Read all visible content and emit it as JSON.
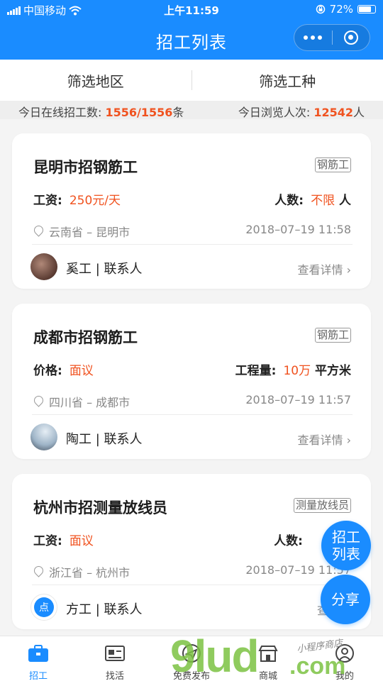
{
  "status": {
    "carrier": "中国移动",
    "time": "上午11:59",
    "battery": "72%"
  },
  "nav": {
    "title": "招工列表"
  },
  "filters": {
    "region": "筛选地区",
    "worktype": "筛选工种"
  },
  "stats": {
    "online_label": "今日在线招工数:",
    "online_value": "1556/1556",
    "online_unit": "条",
    "views_label": "今日浏览人次:",
    "views_value": "12542",
    "views_unit": "人"
  },
  "cards": [
    {
      "title": "昆明市招钢筋工",
      "tag": "钢筋工",
      "left_label": "工资:",
      "left_value": "250元/天",
      "right_label": "人数:",
      "right_value": "不限",
      "right_unit": "人",
      "location": "云南省 – 昆明市",
      "time": "2018–07–19 11:58",
      "contact": "奚工 | 联系人",
      "detail": "查看详情"
    },
    {
      "title": "成都市招钢筋工",
      "tag": "钢筋工",
      "left_label": "价格:",
      "left_value": "面议",
      "right_label": "工程量:",
      "right_value": "10万",
      "right_unit": "平方米",
      "location": "四川省 – 成都市",
      "time": "2018–07–19 11:57",
      "contact": "陶工 | 联系人",
      "detail": "查看详情"
    },
    {
      "title": "杭州市招测量放线员",
      "tag": "测量放线员",
      "left_label": "工资:",
      "left_value": "面议",
      "right_label": "人数:",
      "right_value": "",
      "right_unit": "",
      "location": "浙江省 – 杭州市",
      "time": "2018–07–19 11:57",
      "contact": "方工 | 联系人",
      "detail": "查看详"
    }
  ],
  "avatar3_text": "点",
  "fab": {
    "list_line1": "招工",
    "list_line2": "列表",
    "share": "分享"
  },
  "tabs": [
    {
      "label": "招工",
      "icon": "briefcase-icon"
    },
    {
      "label": "找活",
      "icon": "id-card-icon"
    },
    {
      "label": "免费发布",
      "icon": "send-icon"
    },
    {
      "label": "商城",
      "icon": "store-icon"
    },
    {
      "label": "我的",
      "icon": "user-icon"
    }
  ],
  "watermark": {
    "logo": "9lud",
    "com": ".com",
    "tagline": "小程序商店"
  },
  "colors": {
    "primary": "#1a8cff",
    "accent": "#f0521f",
    "watermark_green": "#7cc242"
  }
}
